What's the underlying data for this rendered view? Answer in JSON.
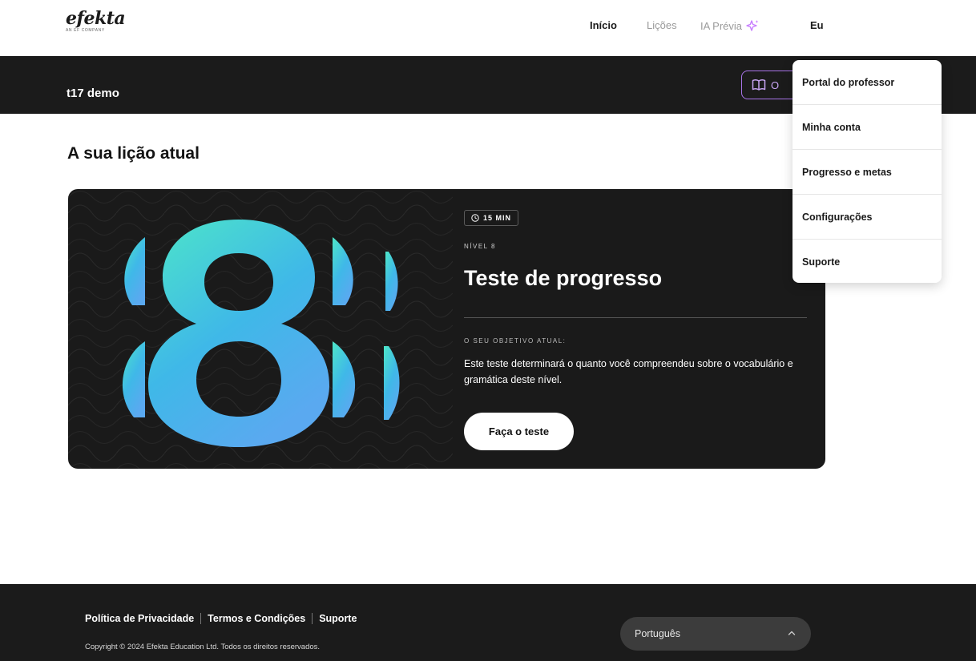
{
  "header": {
    "logo_text": "efekta",
    "logo_tagline": "AN EF COMPANY",
    "nav": {
      "home": "Início",
      "lessons": "Lições",
      "ai_preview": "IA Prévia",
      "me": "Eu"
    },
    "colors": {
      "active": "#1a1a1a",
      "inactive": "#9a9a9a",
      "sparkle": "#c77dff"
    }
  },
  "class_bar": {
    "title": "t17 demo",
    "button_label": "O",
    "button_icon": "book-icon",
    "accent_color": "#a874e8"
  },
  "main": {
    "section_title": "A sua lição atual",
    "lesson": {
      "art_label": "8",
      "duration": "15 MIN",
      "level": "NÍVEL 8",
      "title": "Teste de progresso",
      "goal_label": "O SEU OBJETIVO ATUAL:",
      "goal_text": "Este teste determinará o quanto você compreendeu sobre o vocabulário e gramática deste nível.",
      "cta_label": "Faça o teste"
    }
  },
  "dropdown": {
    "items": [
      {
        "label": "Portal do professor"
      },
      {
        "label": "Minha conta"
      },
      {
        "label": "Progresso e metas"
      },
      {
        "label": "Configurações"
      },
      {
        "label": "Suporte"
      }
    ]
  },
  "footer": {
    "links": [
      "Política de Privacidade",
      "Termos e Condições",
      "Suporte"
    ],
    "copyright": "Copyright © 2024 Efekta Education Ltd. Todos os direitos reservados.",
    "language": "Português"
  }
}
